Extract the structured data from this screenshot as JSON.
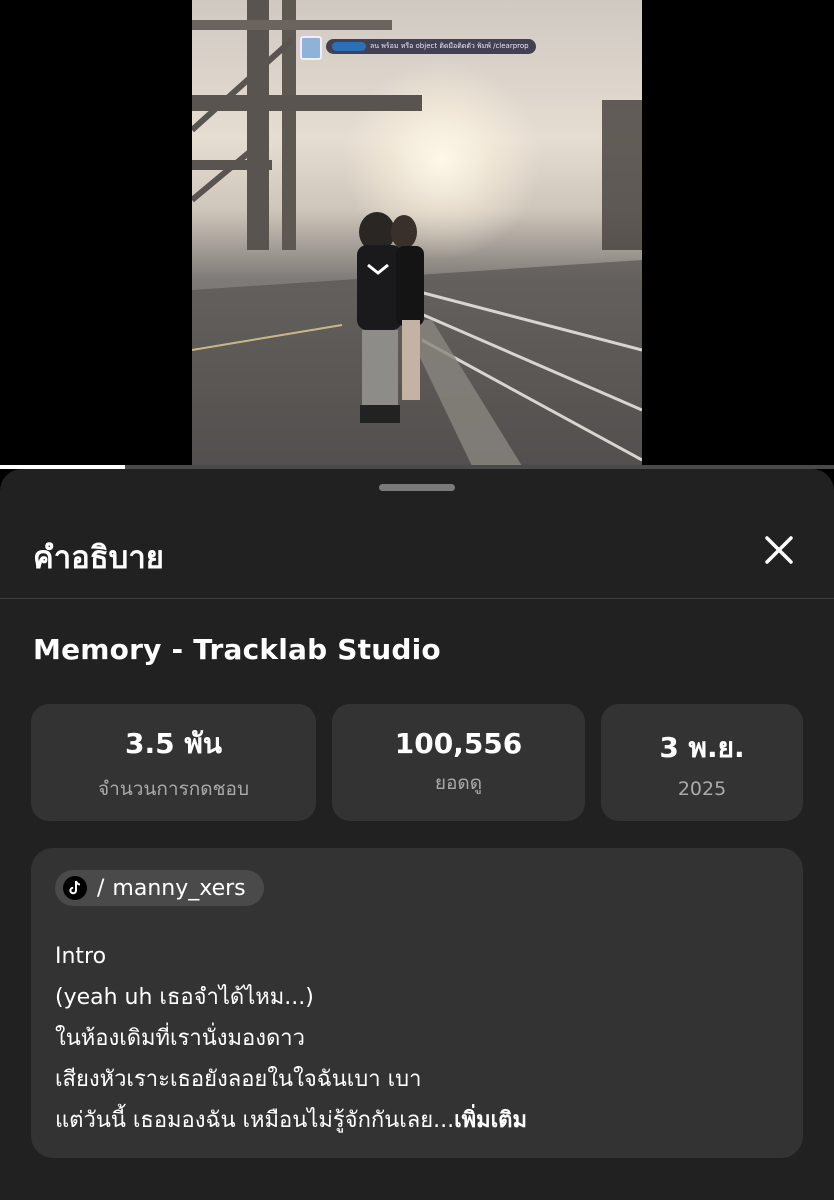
{
  "video": {
    "hud_message": "ลน พร้อม หรือ object ติดมือติดตัว พิมพ์ /clearprop",
    "progress_fraction": 0.15
  },
  "sheet": {
    "title": "คำอธิบาย",
    "close_icon": "close-icon",
    "video_title": "Memory - Tracklab Studio",
    "stats": {
      "likes": {
        "value": "3.5 พัน",
        "label": "จำนวนการกดชอบ"
      },
      "views": {
        "value": "100,556",
        "label": "ยอดดู"
      },
      "date": {
        "value": "3 พ.ย.",
        "label": "2025"
      }
    },
    "description": {
      "source_icon": "tiktok-icon",
      "handle_separator": "/",
      "handle": "manny_xers",
      "lines": [
        "Intro",
        "(yeah uh เธอจำได้ไหม...)",
        "ในห้องเดิมที่เรานั่งมองดาว",
        "เสียงหัวเราะเธอยังลอยในใจฉันเบา เบา",
        "แต่วันนี้ เธอมองฉัน เหมือนไม่รู้จักกันเลย..."
      ],
      "more_label": "เพิ่มเติม"
    }
  },
  "colors": {
    "sheet_bg": "#212121",
    "card_bg": "#333333",
    "muted_text": "#aaaaaa"
  }
}
